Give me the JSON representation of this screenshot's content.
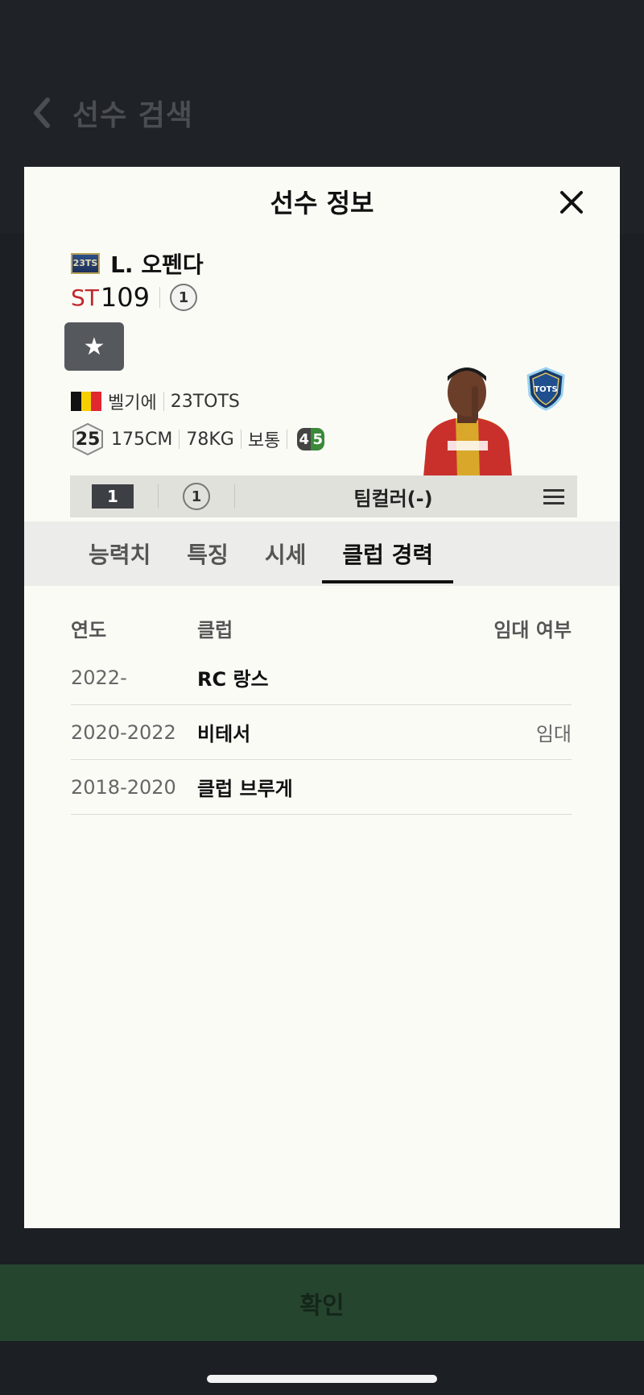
{
  "background": {
    "title": "선수 검색",
    "back_icon": "chevron-left-icon"
  },
  "modal": {
    "title": "선수 정보",
    "close_icon": "close-icon"
  },
  "player": {
    "season_badge": "23TS",
    "name": "L. 오펜다",
    "position": "ST",
    "ovr": "109",
    "grade": "1",
    "nation": "벨기에",
    "season": "23TOTS",
    "weak_foot_rating": "25",
    "height": "175CM",
    "weight": "78KG",
    "body_type": "보통",
    "foot_left": "4",
    "foot_right": "5",
    "favorite_icon": "star-icon",
    "flag_colors": [
      "#111111",
      "#f5d000",
      "#e0282e"
    ]
  },
  "team_bar": {
    "level": "1",
    "grade": "1",
    "team_color": "팀컬러(-)",
    "menu_icon": "hamburger-icon"
  },
  "tabs": [
    {
      "label": "능력치",
      "active": false
    },
    {
      "label": "특징",
      "active": false
    },
    {
      "label": "시세",
      "active": false
    },
    {
      "label": "클럽 경력",
      "active": true
    }
  ],
  "history": {
    "headers": {
      "year": "연도",
      "club": "클럽",
      "loan": "임대 여부"
    },
    "rows": [
      {
        "year": "2022-",
        "club": "RC 랑스",
        "loan": ""
      },
      {
        "year": "2020-2022",
        "club": "비테서",
        "loan": "임대"
      },
      {
        "year": "2018-2020",
        "club": "클럽 브루게",
        "loan": ""
      }
    ]
  },
  "confirm": {
    "label": "확인"
  }
}
